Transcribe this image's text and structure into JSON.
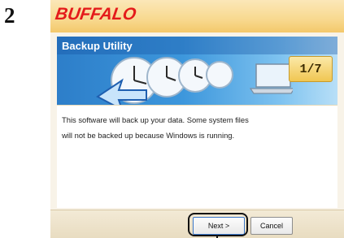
{
  "step": {
    "number": "2"
  },
  "window": {
    "brand": "BUFFALO",
    "banner_title": "Backup Utility",
    "step_indicator": "1/7",
    "message_line1": "This software will back up your data. Some system files",
    "message_line2": "will not be backed up because Windows is running."
  },
  "buttons": {
    "next_label": "Next >",
    "cancel_label": "Cancel"
  },
  "colors": {
    "brand_red": "#e41b1b",
    "banner_blue": "#2d7ec9",
    "badge_gold": "#f0c652"
  }
}
